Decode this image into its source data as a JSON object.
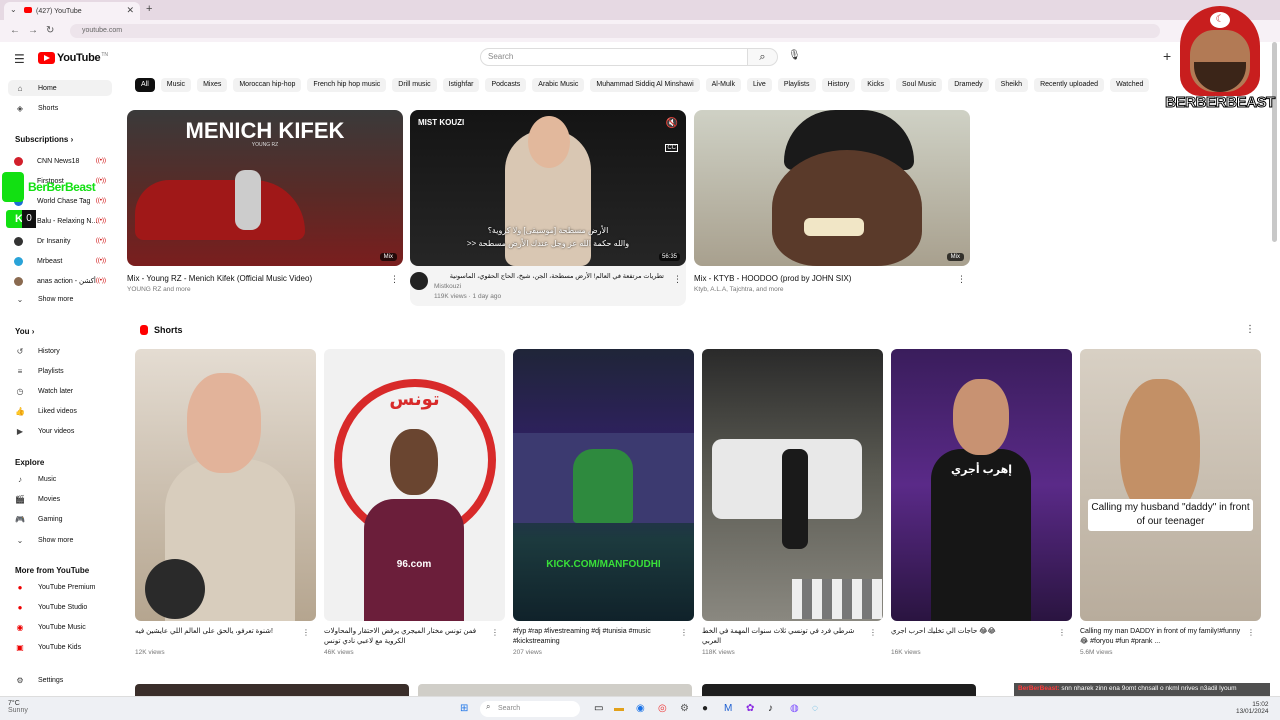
{
  "browser": {
    "tab_title": "(427) YouTube",
    "url": "youtube.com"
  },
  "header": {
    "logo": "YouTube",
    "logo_sup": "TN",
    "search_placeholder": "Search"
  },
  "chips": [
    "All",
    "Music",
    "Mixes",
    "Moroccan hip-hop",
    "French hip hop music",
    "Drill music",
    "Istighfar",
    "Podcasts",
    "Arabic Music",
    "Muhammad Siddiq Al Minshawi",
    "Al-Mulk",
    "Live",
    "Playlists",
    "History",
    "Kicks",
    "Soul Music",
    "Dramedy",
    "Sheikh",
    "Recently uploaded",
    "Watched"
  ],
  "sidebar": {
    "home": "Home",
    "shorts": "Shorts",
    "subscriptions_header": "Subscriptions",
    "subscriptions": [
      {
        "name": "CNN News18",
        "color": "#d21f2b"
      },
      {
        "name": "Firstpost",
        "color": "#2a2a2a"
      },
      {
        "name": "World Chase Tag",
        "color": "#1d6ed6"
      },
      {
        "name": "Balu - Relaxing N...",
        "color": "#6a9b5a"
      },
      {
        "name": "Dr Insanity",
        "color": "#333"
      },
      {
        "name": "Mrbeast",
        "color": "#2aa3d8"
      },
      {
        "name": "anas action - أكشن",
        "color": "#8a6a50"
      }
    ],
    "show_more": "Show more",
    "you_header": "You",
    "you_items": [
      "History",
      "Playlists",
      "Watch later",
      "Liked videos",
      "Your videos"
    ],
    "explore_header": "Explore",
    "explore_items": [
      "Music",
      "Movies",
      "Gaming"
    ],
    "show_more_2": "Show more",
    "more_header": "More from YouTube",
    "more_items": [
      "YouTube Premium",
      "YouTube Studio",
      "YouTube Music",
      "YouTube Kids"
    ],
    "settings": "Settings"
  },
  "videos": [
    {
      "title": "Mix - Young RZ - Menich Kifek (Official Music Video)",
      "meta": "YOUNG RZ and more",
      "badge": "Mix",
      "thumb_text": "MENICH KIFEK",
      "thumb_sub": "YOUNG RZ"
    },
    {
      "title": "تطريات مرتفعة في العالم! الأرض مسطحة، الجن، شيخ، الحاج الحقوي، الماسونية",
      "channel": "Mistkouzi",
      "meta": "119K views · 1 day ago",
      "badge": "56:35",
      "thumb_text": "MIST KOUZI",
      "caption_1": "الأرض مسطحة [موسيقى] ولا كروية؟",
      "caption_2": ">> والله حكمة الله عز وجل عندك الأرض مسطحة"
    },
    {
      "title": "Mix - KTYB - HOODOO (prod by JOHN SIX)",
      "meta": "Ktyb, A.L.A, Tajchtra, and more",
      "badge": "Mix"
    }
  ],
  "shorts": {
    "header": "Shorts",
    "items": [
      {
        "title": "شنوة تعرفو، يالحق على العالم اللي عايشين فيه!",
        "views": "12K views"
      },
      {
        "title": "فمن تونس مختار الميجري يرفض الاحتقار والمحاولات الكروية مع لاعبي نادي تونس",
        "views": "46K views",
        "badge_text": "تونس",
        "shirt": "96.com"
      },
      {
        "title": "#fyp #rap #livestreaming #dj #tunisia #music #kickstreaming",
        "views": "207 views",
        "overlay": "KICK.COM/MANFOUDHI"
      },
      {
        "title": "شرطي فرد في تونسي ثلاث سنوات المهمة في الخط العربي",
        "views": "118K views"
      },
      {
        "title": "حاجات الي تخليك احرب اجري 😂😂",
        "views": "16K views",
        "overlay": "إهرب أجري"
      },
      {
        "title": "Calling my man DADDY in front of my family!#funny 😂 #foryou #fun #prank ...",
        "views": "5.6M views",
        "overlay": "Calling my husband \"daddy\" in front of our teenager"
      }
    ]
  },
  "overlay": {
    "streamer_left": "BerBerBeast",
    "kick_k": "K",
    "kick_0": "0",
    "streamer_logo": "BERBERBEAST",
    "chat_user": "BerBerBeast:",
    "chat_msg": "snn nharek zinn ena 9omt chnsall o nkml nrives n3adil lyoum"
  },
  "taskbar": {
    "weather": "7°C",
    "weather_sub": "Sunny",
    "search": "Search",
    "time": "15:02",
    "date": "13/01/2024"
  }
}
